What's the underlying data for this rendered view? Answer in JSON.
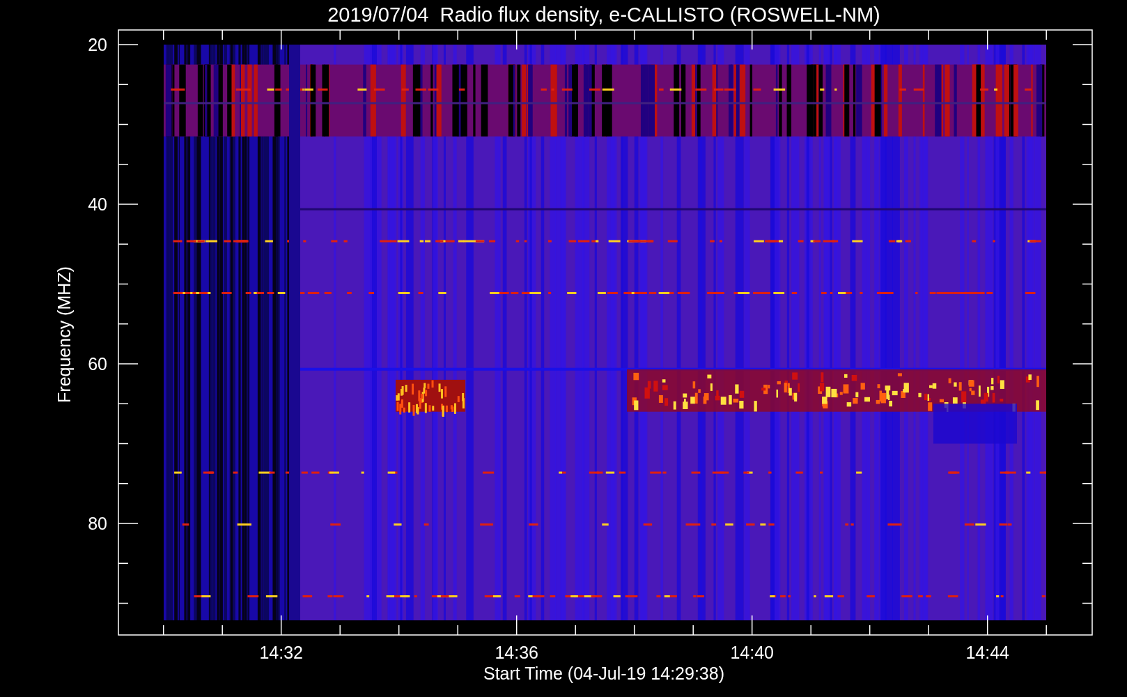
{
  "chart": {
    "title": "2019/07/04  Radio flux density, e-CALLISTO (ROSWELL-NM)",
    "xlabel": "Start Time (04-Jul-19 14:29:38)",
    "ylabel": "Frequency (MHZ)",
    "xticks": [
      "14:32",
      "14:36",
      "14:40",
      "14:44"
    ],
    "yticks": [
      "20",
      "40",
      "60",
      "80"
    ]
  }
}
